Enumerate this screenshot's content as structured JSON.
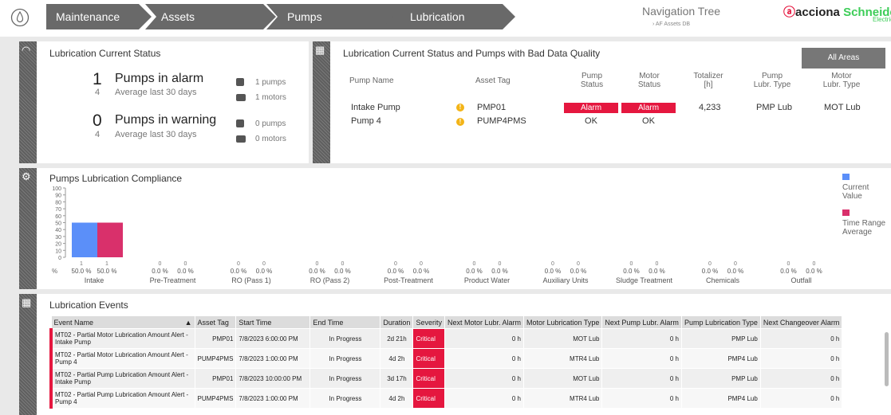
{
  "header": {
    "breadcrumbs": [
      "Maintenance",
      "Assets",
      "Pumps",
      "Lubrication"
    ],
    "nav_title": "Navigation Tree",
    "nav_sub": "AF Assets DB",
    "brand1": "acciona",
    "brand2": "Schneider",
    "brand3": "Electric"
  },
  "status": {
    "title": "Lubrication Current Status",
    "alarm": {
      "count": "1",
      "label": "Pumps in alarm",
      "avg": "4",
      "avg_label": "Average last 30 days",
      "pumps": "1 pumps",
      "motors": "1 motors"
    },
    "warning": {
      "count": "0",
      "label": "Pumps in warning",
      "avg": "4",
      "avg_label": "Average last 30 days",
      "pumps": "0 pumps",
      "motors": "0 motors"
    }
  },
  "quality": {
    "title": "Lubrication Current Status and Pumps with Bad Data Quality",
    "all_areas": "All Areas",
    "headers": [
      "Pump Name",
      "Asset Tag",
      "Pump\nStatus",
      "Motor\nStatus",
      "Totalizer\n[h]",
      "Pump\nLubr. Type",
      "Motor\nLubr. Type"
    ],
    "rows": [
      {
        "name": "Intake Pump",
        "tag": "PMP01",
        "pump_status": "Alarm",
        "motor_status": "Alarm",
        "totalizer": "4,233",
        "pump_type": "PMP Lub",
        "motor_type": "MOT Lub"
      },
      {
        "name": "Pump 4",
        "tag": "PUMP4PMS",
        "pump_status": "OK",
        "motor_status": "OK",
        "totalizer": "",
        "pump_type": "",
        "motor_type": ""
      }
    ]
  },
  "compliance": {
    "title": "Pumps Lubrication Compliance",
    "pct_label": "%",
    "legend": [
      {
        "name": "Current\nValue",
        "color": "#5b8ff9"
      },
      {
        "name": "Time Range\nAverage",
        "color": "#d9306b"
      }
    ]
  },
  "chart_data": {
    "type": "bar",
    "title": "Pumps Lubrication Compliance",
    "ylim": [
      0,
      100
    ],
    "yticks": [
      "100",
      "90",
      "80",
      "70",
      "60",
      "50",
      "40",
      "30",
      "20",
      "10",
      "0"
    ],
    "categories": [
      "Intake",
      "Pre-Treatment",
      "RO (Pass 1)",
      "RO (Pass 2)",
      "Post-Treatment",
      "Product Water",
      "Auxiliary Units",
      "Sludge Treatment",
      "Chemicals",
      "Outfall"
    ],
    "series": [
      {
        "name": "Current Value",
        "color": "#5b8ff9",
        "values": [
          50,
          0,
          0,
          0,
          0,
          0,
          0,
          0,
          0,
          0
        ]
      },
      {
        "name": "Time Range Average",
        "color": "#d9306b",
        "values": [
          50,
          0,
          0,
          0,
          0,
          0,
          0,
          0,
          0,
          0
        ]
      }
    ],
    "counts": [
      [
        "1",
        "1"
      ],
      [
        "0",
        "0"
      ],
      [
        "0",
        "0"
      ],
      [
        "0",
        "0"
      ],
      [
        "0",
        "0"
      ],
      [
        "0",
        "0"
      ],
      [
        "0",
        "0"
      ],
      [
        "0",
        "0"
      ],
      [
        "0",
        "0"
      ],
      [
        "0",
        "0"
      ]
    ],
    "value_labels": [
      [
        "50.0 %",
        "50.0 %"
      ],
      [
        "0.0 %",
        "0.0 %"
      ],
      [
        "0.0 %",
        "0.0 %"
      ],
      [
        "0.0 %",
        "0.0 %"
      ],
      [
        "0.0 %",
        "0.0 %"
      ],
      [
        "0.0 %",
        "0.0 %"
      ],
      [
        "0.0 %",
        "0.0 %"
      ],
      [
        "0.0 %",
        "0.0 %"
      ],
      [
        "0.0 %",
        "0.0 %"
      ],
      [
        "0.0 %",
        "0.0 %"
      ]
    ]
  },
  "events": {
    "title": "Lubrication Events",
    "headers": [
      "Event Name",
      "Asset Tag",
      "Start Time",
      "End Time",
      "Duration",
      "Severity",
      "Next Motor Lubr. Alarm",
      "Motor Lubrication Type",
      "Next Pump Lubr. Alarm",
      "Pump Lubrication Type",
      "Next Changeover Alarm"
    ],
    "rows": [
      [
        "MT02 - Partial Motor Lubrication Amount Alert - Intake Pump",
        "PMP01",
        "7/8/2023 6:00:00 PM",
        "In Progress",
        "2d 21h",
        "Critical",
        "0 h",
        "MOT Lub",
        "0 h",
        "PMP Lub",
        "0 h"
      ],
      [
        "MT02 - Partial Motor Lubrication Amount Alert - Pump 4",
        "PUMP4PMS",
        "7/8/2023 1:00:00 PM",
        "In Progress",
        "4d 2h",
        "Critical",
        "0 h",
        "MTR4 Lub",
        "0 h",
        "PMP4 Lub",
        "0 h"
      ],
      [
        "MT02 - Partial Pump Lubrication Amount Alert - Intake Pump",
        "PMP01",
        "7/8/2023 10:00:00 PM",
        "In Progress",
        "3d 17h",
        "Critical",
        "0 h",
        "MOT Lub",
        "0 h",
        "PMP Lub",
        "0 h"
      ],
      [
        "MT02 - Partial Pump Lubrication Amount Alert - Pump 4",
        "PUMP4PMS",
        "7/8/2023 1:00:00 PM",
        "In Progress",
        "4d 2h",
        "Critical",
        "0 h",
        "MTR4 Lub",
        "0 h",
        "PMP4 Lub",
        "0 h"
      ]
    ]
  }
}
